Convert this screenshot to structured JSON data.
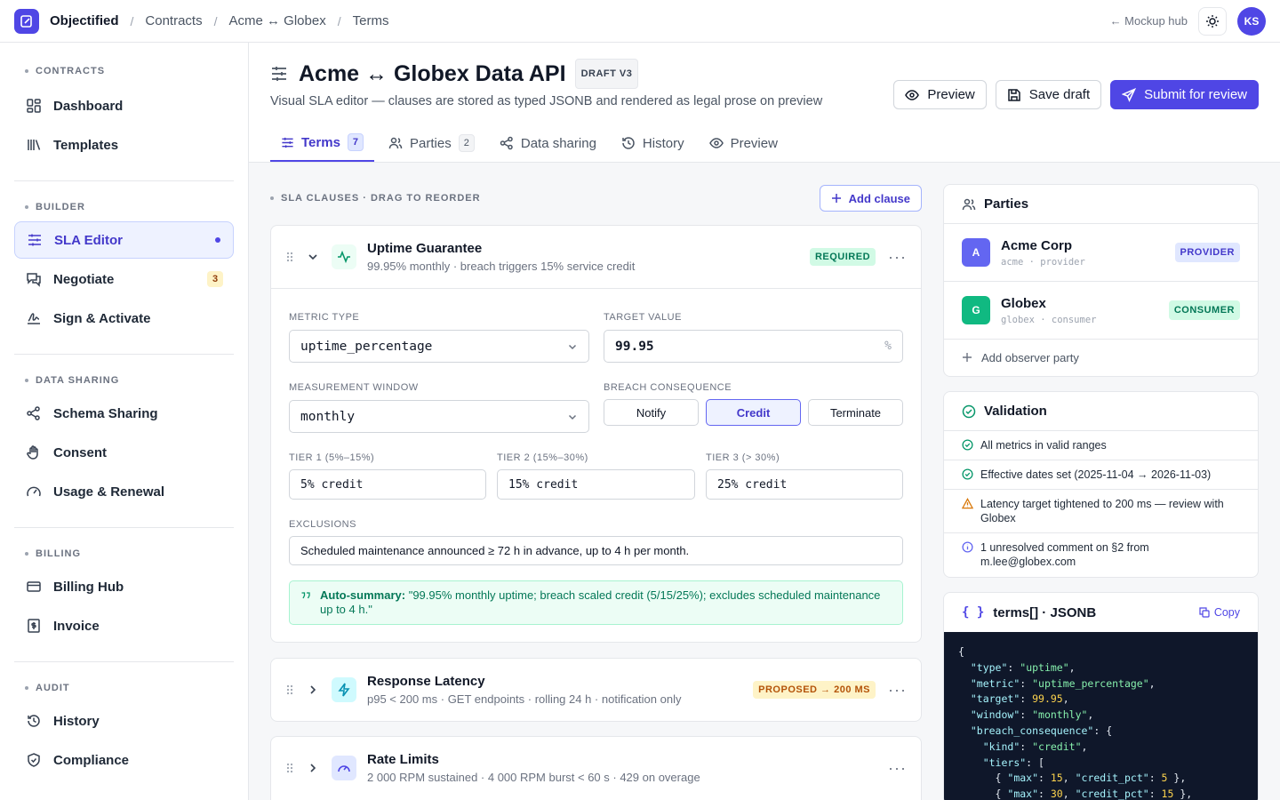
{
  "topbar": {
    "brand": "Objectified",
    "breadcrumbs": [
      "Contracts",
      "Acme ↔ Globex",
      "Terms"
    ],
    "hub_link": "← Mockup hub",
    "avatar_initials": "KS"
  },
  "sidebar": {
    "sections": [
      {
        "title": "CONTRACTS",
        "items": [
          {
            "label": "Dashboard"
          },
          {
            "label": "Templates"
          }
        ]
      },
      {
        "title": "BUILDER",
        "items": [
          {
            "label": "SLA Editor"
          },
          {
            "label": "Negotiate",
            "badge": "3"
          },
          {
            "label": "Sign & Activate"
          }
        ]
      },
      {
        "title": "DATA SHARING",
        "items": [
          {
            "label": "Schema Sharing"
          },
          {
            "label": "Consent"
          },
          {
            "label": "Usage & Renewal"
          }
        ]
      },
      {
        "title": "BILLING",
        "items": [
          {
            "label": "Billing Hub"
          },
          {
            "label": "Invoice"
          }
        ]
      },
      {
        "title": "AUDIT",
        "items": [
          {
            "label": "History"
          },
          {
            "label": "Compliance"
          }
        ]
      }
    ]
  },
  "header": {
    "title": "Acme ↔ Globex Data API",
    "draft_badge": "DRAFT V3",
    "subtitle": "Visual SLA editor — clauses are stored as typed JSONB and rendered as legal prose on preview",
    "preview_label": "Preview",
    "save_label": "Save draft",
    "submit_label": "Submit for review"
  },
  "tabs": [
    {
      "label": "Terms",
      "count": "7"
    },
    {
      "label": "Parties",
      "count": "2"
    },
    {
      "label": "Data sharing"
    },
    {
      "label": "History"
    },
    {
      "label": "Preview"
    }
  ],
  "clauses": {
    "section_label": "SLA CLAUSES · DRAG TO REORDER",
    "add_label": "Add clause",
    "uptime": {
      "title": "Uptime Guarantee",
      "subtitle": "99.95% monthly · breach triggers 15% service credit",
      "badge": "REQUIRED",
      "metric_type_label": "METRIC TYPE",
      "metric_type_value": "uptime_percentage",
      "target_label": "TARGET VALUE",
      "target_value": "99.95",
      "target_unit": "%",
      "window_label": "MEASUREMENT WINDOW",
      "window_value": "monthly",
      "breach_label": "BREACH CONSEQUENCE",
      "breach_options": [
        "Notify",
        "Credit",
        "Terminate"
      ],
      "breach_selected": "Credit",
      "tier1_label": "TIER 1 (5%–15%)",
      "tier1_value": "5% credit",
      "tier2_label": "TIER 2 (15%–30%)",
      "tier2_value": "15% credit",
      "tier3_label": "TIER 3 (> 30%)",
      "tier3_value": "25% credit",
      "exclusions_label": "EXCLUSIONS",
      "exclusions_value": "Scheduled maintenance announced ≥ 72 h in advance, up to 4 h per month.",
      "summary_label": "Auto-summary:",
      "summary_text": "\"99.95% monthly uptime; breach scaled credit (5/15/25%); excludes scheduled maintenance up to 4 h.\""
    },
    "latency": {
      "title": "Response Latency",
      "subtitle": "p95 < 200 ms · GET endpoints · rolling 24 h · notification only",
      "badge": "PROPOSED → 200 MS"
    },
    "rate": {
      "title": "Rate Limits",
      "subtitle": "2 000 RPM sustained · 4 000 RPM burst < 60 s · 429 on overage"
    }
  },
  "parties_panel": {
    "title": "Parties",
    "parties": [
      {
        "initial": "A",
        "name": "Acme Corp",
        "meta": "acme · provider",
        "role": "PROVIDER"
      },
      {
        "initial": "G",
        "name": "Globex",
        "meta": "globex · consumer",
        "role": "CONSUMER"
      }
    ],
    "add_observer": "Add observer party"
  },
  "validation": {
    "title": "Validation",
    "items": [
      {
        "status": "ok",
        "text": "All metrics in valid ranges"
      },
      {
        "status": "ok",
        "text": "Effective dates set (2025-11-04 → 2026-11-03)"
      },
      {
        "status": "warn",
        "text": "Latency target tightened to 200 ms — review with Globex"
      },
      {
        "status": "info",
        "text": "1 unresolved comment on §2 from m.lee@globex.com"
      }
    ]
  },
  "jsonb": {
    "title": "terms[] · JSONB",
    "copy_label": "Copy",
    "code": "{\n  \"type\": \"uptime\",\n  \"metric\": \"uptime_percentage\",\n  \"target\": 99.95,\n  \"window\": \"monthly\",\n  \"breach_consequence\": {\n    \"kind\": \"credit\",\n    \"tiers\": [\n      { \"max\": 15, \"credit_pct\": 5 },\n      { \"max\": 30, \"credit_pct\": 15 },"
  },
  "colors": {
    "accent": "#4f46e5",
    "success": "#059669",
    "warning": "#d97706"
  }
}
